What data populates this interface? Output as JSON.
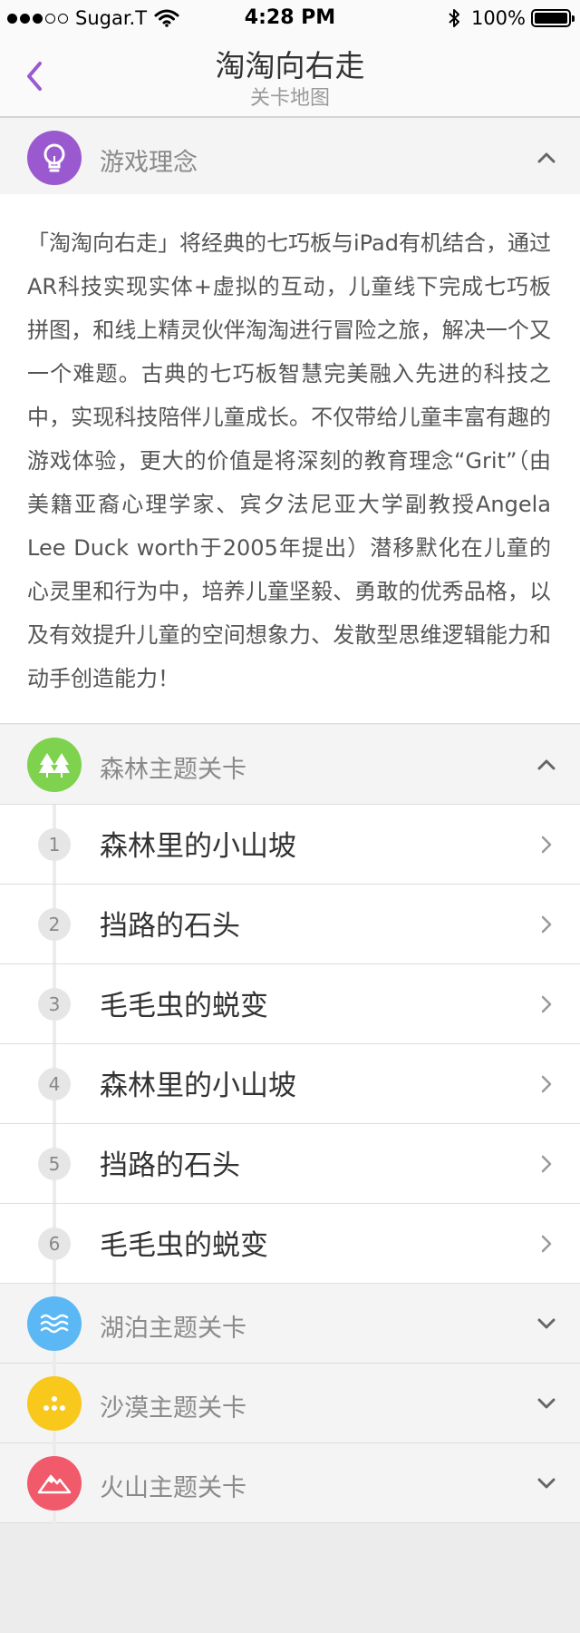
{
  "status_bar": {
    "carrier": "Sugar.T",
    "time": "4:28 PM",
    "battery": "100%",
    "battery_level": 1.0,
    "signal_bars": 3
  },
  "nav": {
    "title": "淘淘向右走",
    "subtitle": "关卡地图",
    "back_icon": "chevron-left-icon"
  },
  "colors": {
    "accent": "#9b59d0",
    "concept": "#9b59d0",
    "forest": "#7ed24e",
    "lake": "#5bb8f5",
    "desert": "#f8c81c",
    "volcano": "#f15a6b"
  },
  "concept": {
    "label": "游戏理念",
    "icon": "lightbulb-icon",
    "text": "「淘淘向右走」将经典的七巧板与iPad有机结合，通过AR科技实现实体+虚拟的互动，儿童线下完成七巧板拼图，和线上精灵伙伴淘淘进行冒险之旅，解决一个又一个难题。古典的七巧板智慧完美融入先进的科技之中，实现科技陪伴儿童成长。不仅带给儿童丰富有趣的游戏体验，更大的价值是将深刻的教育理念“Grit”（由美籍亚裔心理学家、宾夕法尼亚大学副教授Angela Lee Duck worth于2005年提出）潜移默化在儿童的心灵里和行为中，培养儿童坚毅、勇敢的优秀品格，以及有效提升儿童的空间想象力、发散型思维逻辑能力和动手创造能力！"
  },
  "sections": {
    "forest": {
      "label": "森林主题关卡",
      "icon": "trees-icon",
      "expanded": true
    },
    "lake": {
      "label": "湖泊主题关卡",
      "icon": "waves-icon",
      "expanded": false
    },
    "desert": {
      "label": "沙漠主题关卡",
      "icon": "dots-icon",
      "expanded": false
    },
    "volcano": {
      "label": "火山主题关卡",
      "icon": "mountain-icon",
      "expanded": false
    }
  },
  "levels": [
    {
      "num": "1",
      "name": "森林里的小山坡"
    },
    {
      "num": "2",
      "name": "挡路的石头"
    },
    {
      "num": "3",
      "name": "毛毛虫的蜕变"
    },
    {
      "num": "4",
      "name": "森林里的小山坡"
    },
    {
      "num": "5",
      "name": "挡路的石头"
    },
    {
      "num": "6",
      "name": "毛毛虫的蜕变"
    }
  ]
}
